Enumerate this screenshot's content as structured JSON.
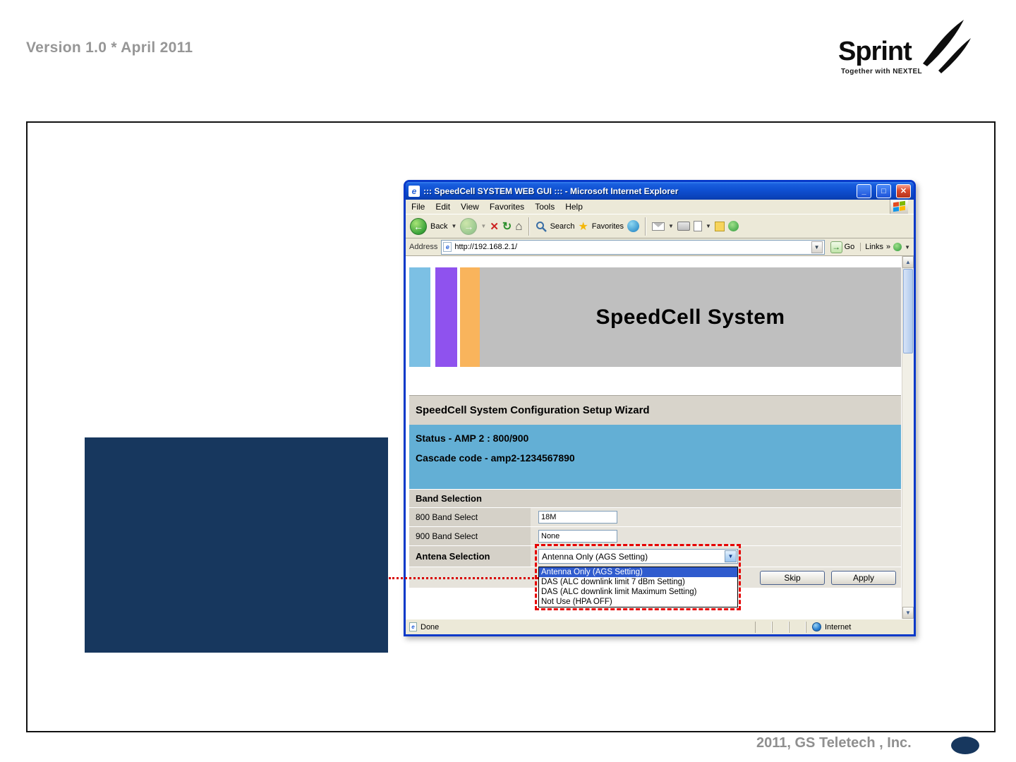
{
  "slide": {
    "version_label": "Version 1.0 * April 2011",
    "footer_credit": "2011, GS Teletech , Inc.",
    "logo": {
      "brand": "Sprint",
      "tagline": "Together with NEXTEL"
    }
  },
  "browser": {
    "window_title": "::: SpeedCell SYSTEM WEB GUI ::: - Microsoft Internet Explorer",
    "menu": [
      "File",
      "Edit",
      "View",
      "Favorites",
      "Tools",
      "Help"
    ],
    "toolbar": {
      "back": "Back",
      "search": "Search",
      "favorites": "Favorites"
    },
    "address": {
      "label": "Address",
      "url": "http://192.168.2.1/",
      "go": "Go",
      "links": "Links",
      "chevron": "»"
    },
    "status": {
      "done": "Done",
      "zone": "Internet"
    }
  },
  "page": {
    "banner_title": "SpeedCell System",
    "wizard_title": "SpeedCell System Configuration Setup Wizard",
    "status_line": "Status - AMP 2 : 800/900",
    "cascade_line": "Cascade code - amp2-1234567890",
    "band_section_title": "Band Selection",
    "band_rows": [
      {
        "label": "800 Band Select",
        "value": "18M"
      },
      {
        "label": "900 Band Select",
        "value": "None"
      }
    ],
    "antenna_label": "Antena Selection",
    "antenna_selected": "Antenna Only (AGS Setting)",
    "antenna_options": [
      "Antenna Only (AGS Setting)",
      "DAS (ALC downlink limit 7 dBm Setting)",
      "DAS (ALC downlink limit Maximum Setting)",
      "Not Use (HPA OFF)"
    ],
    "skip_button": "Skip",
    "apply_button": "Apply"
  },
  "colors": {
    "navy": "#17375E",
    "status_blue": "#63AFD5",
    "banner_gray": "#BFBFBF",
    "bar_blue": "#7CC0E4",
    "bar_purple": "#8F52EE",
    "bar_orange": "#F9B45C",
    "highlight_red": "#E60000",
    "selection_blue": "#2F5BCE"
  }
}
